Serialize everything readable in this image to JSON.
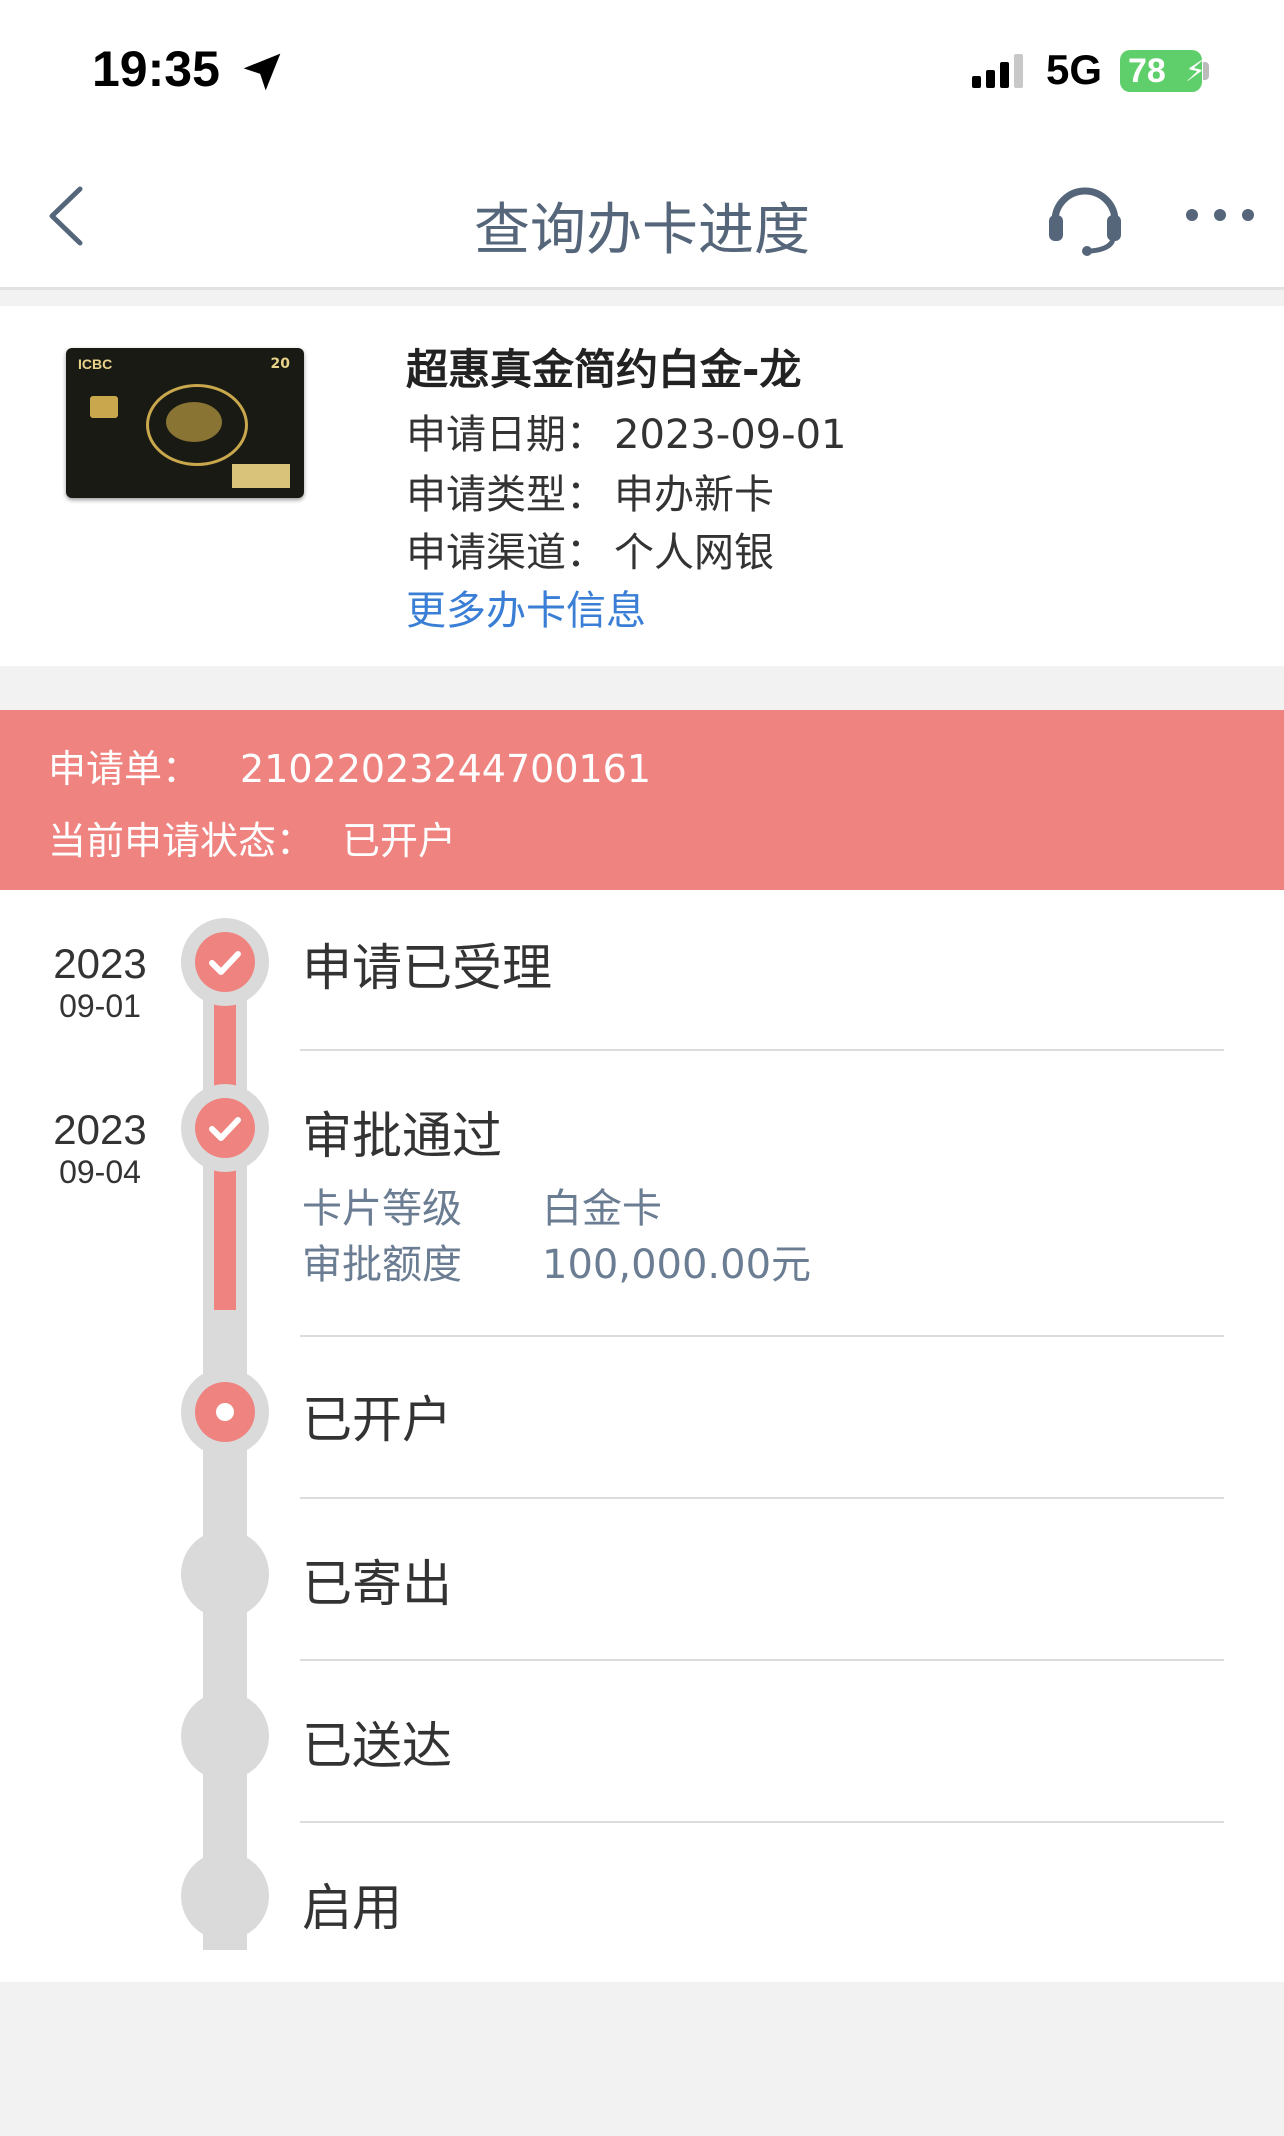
{
  "status_bar": {
    "time": "19:35",
    "network": "5G",
    "battery": "78"
  },
  "nav": {
    "title": "查询办卡进度"
  },
  "card": {
    "brand_text": "ICBC",
    "name": "超惠真金简约白金-龙",
    "apply_date_label": "申请日期：",
    "apply_date": "2023-09-01",
    "apply_type_label": "申请类型：",
    "apply_type": "申办新卡",
    "apply_channel_label": "申请渠道：",
    "apply_channel": "个人网银",
    "more_link": "更多办卡信息"
  },
  "banner": {
    "order_label": "申请单：",
    "order_no": "21022023244700161",
    "status_label": "当前申请状态：",
    "status": "已开户"
  },
  "timeline": [
    {
      "label": "申请已受理",
      "year": "2023",
      "md": "09-01",
      "state": "done"
    },
    {
      "label": "审批通过",
      "year": "2023",
      "md": "09-04",
      "state": "done",
      "details": [
        {
          "key": "卡片等级",
          "value": "白金卡"
        },
        {
          "key": "审批额度",
          "value": "100,000.00元"
        }
      ]
    },
    {
      "label": "已开户",
      "state": "current"
    },
    {
      "label": "已寄出",
      "state": "pending"
    },
    {
      "label": "已送达",
      "state": "pending"
    },
    {
      "label": "启用",
      "state": "pending"
    }
  ],
  "colors": {
    "accent": "#ef8380",
    "link": "#3a7fd5",
    "track": "#dadada",
    "title": "#55657a"
  }
}
